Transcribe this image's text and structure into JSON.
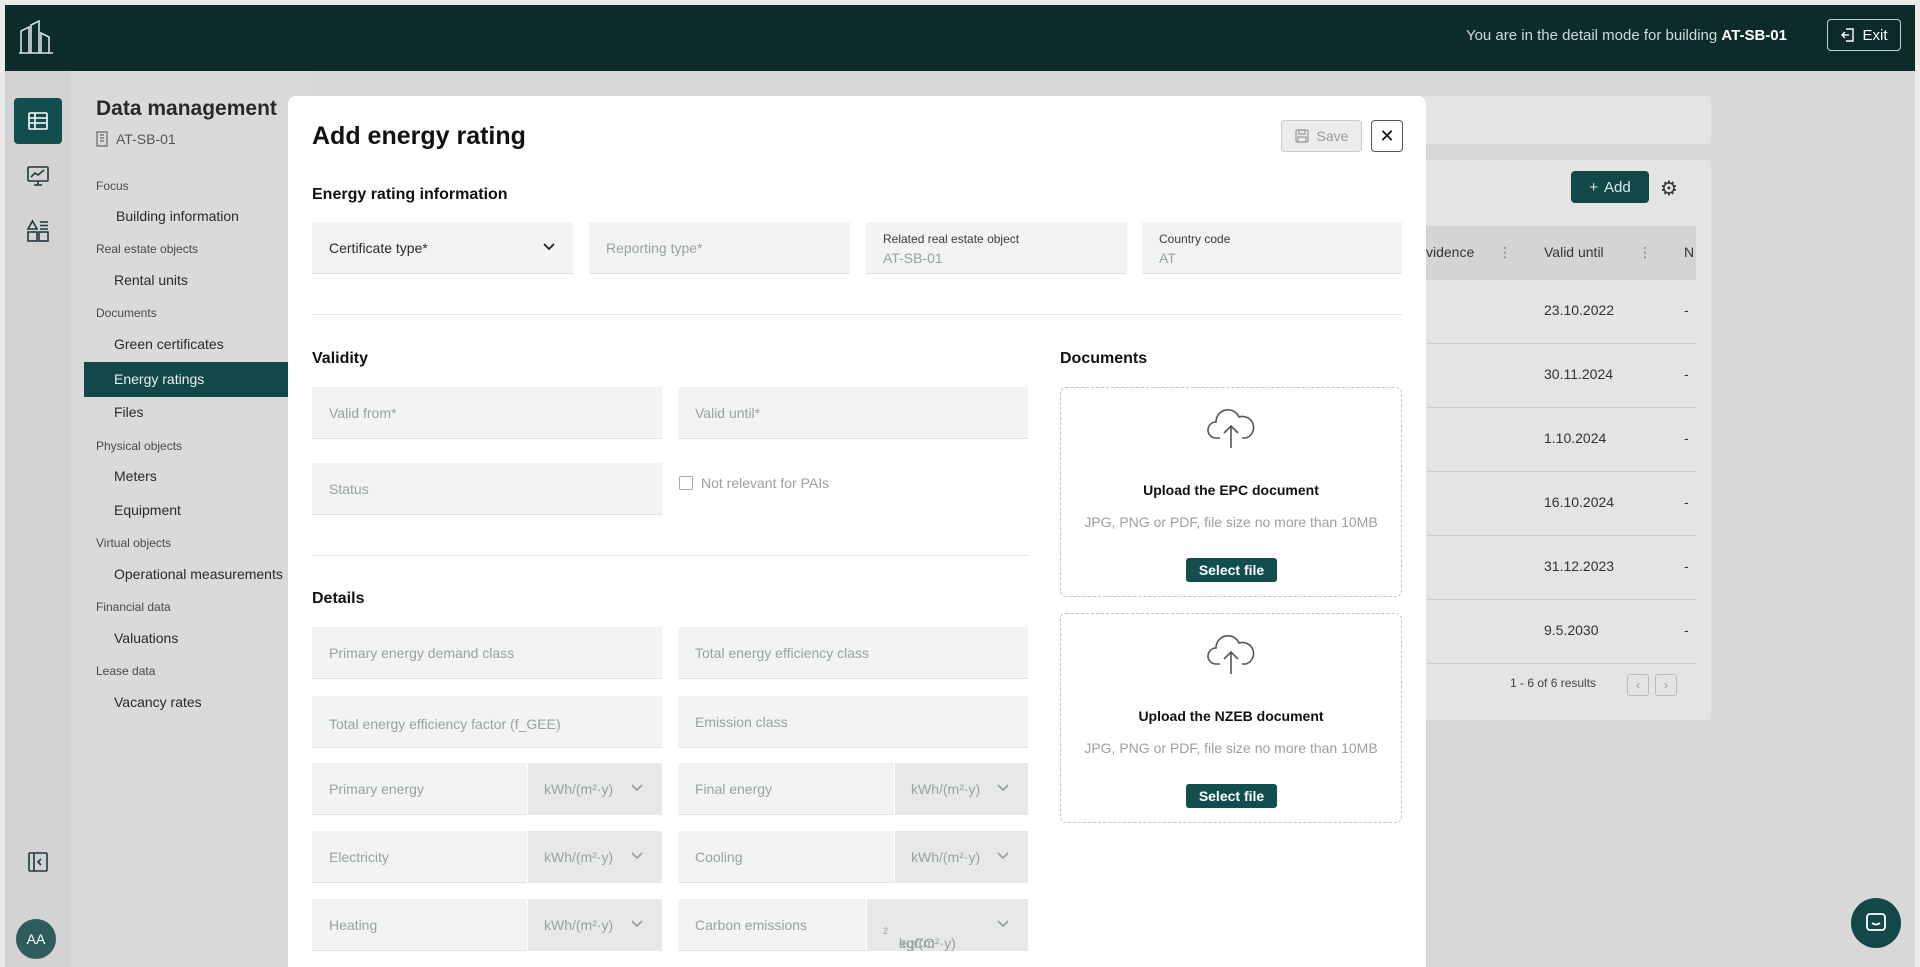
{
  "topbar": {
    "message_prefix": "You are in the detail mode for building ",
    "building_code": "AT-SB-01",
    "exit_label": "Exit"
  },
  "rail": {
    "items": [
      {
        "icon": "table-icon",
        "active": true
      },
      {
        "icon": "presentation-chart-icon",
        "active": false
      },
      {
        "icon": "widgets-icon",
        "active": false
      }
    ],
    "collapse_icon": "collapse-sidebar-icon",
    "avatar": "AA"
  },
  "sidepanel": {
    "title": "Data management",
    "building": "AT-SB-01",
    "groups": {
      "focus": "Focus",
      "real_estate": "Real estate objects",
      "documents": "Documents",
      "physical": "Physical objects",
      "virtual": "Virtual objects",
      "financial": "Financial data",
      "lease": "Lease data"
    },
    "items": {
      "building_information": "Building information",
      "rental_units": "Rental units",
      "green_certificates": "Green certificates",
      "energy_ratings": "Energy ratings",
      "files": "Files",
      "meters": "Meters",
      "equipment": "Equipment",
      "operational_measurements": "Operational measurements",
      "valuations": "Valuations",
      "vacancy_rates": "Vacancy rates"
    }
  },
  "background_table": {
    "add_label": "Add",
    "columns": [
      "vidence",
      "Valid until",
      "N"
    ],
    "valid_until": [
      "23.10.2022",
      "30.11.2024",
      "1.10.2024",
      "16.10.2024",
      "31.12.2023",
      "9.5.2030"
    ],
    "last_col": [
      "-",
      "-",
      "-",
      "-",
      "-",
      "-"
    ],
    "pager": "1 -  6 of  6 results"
  },
  "modal": {
    "title": "Add energy rating",
    "save_label": "Save",
    "close_icon": "close-icon",
    "sections": {
      "info": "Energy rating information",
      "validity": "Validity",
      "documents": "Documents",
      "details": "Details"
    },
    "info_fields": {
      "certificate_type": "Certificate type*",
      "reporting_type": "Reporting type*",
      "related_object_label": "Related real estate object",
      "related_object_value": "AT-SB-01",
      "country_code_label": "Country code",
      "country_code_value": "AT"
    },
    "validity_fields": {
      "valid_from": "Valid from*",
      "valid_until": "Valid until*",
      "status": "Status",
      "not_relevant": "Not relevant for PAIs"
    },
    "details_fields": {
      "primary_energy_demand_class": "Primary energy demand class",
      "total_energy_efficiency_class": "Total energy efficiency class",
      "total_energy_efficiency_factor": "Total energy efficiency factor (f_GEE)",
      "emission_class": "Emission class",
      "primary_energy": "Primary energy",
      "final_energy": "Final energy",
      "electricity": "Electricity",
      "cooling": "Cooling",
      "heating": "Heating",
      "carbon_emissions": "Carbon emissions"
    },
    "units": {
      "energy": "kWh/(m²·y)",
      "carbon_prefix": "kgCO",
      "carbon_sub": "2",
      "carbon_suffix": "eq/(m²·y)"
    },
    "uploads": {
      "epc_title": "Upload the EPC document",
      "nzeb_title": "Upload the NZEB document",
      "hint": "JPG, PNG or PDF, file size no more than 10MB",
      "select_label": "Select file"
    }
  },
  "colors": {
    "topbar": "#0d2b2b",
    "accent": "#134e4e",
    "field_bg": "#f2f3f3"
  }
}
